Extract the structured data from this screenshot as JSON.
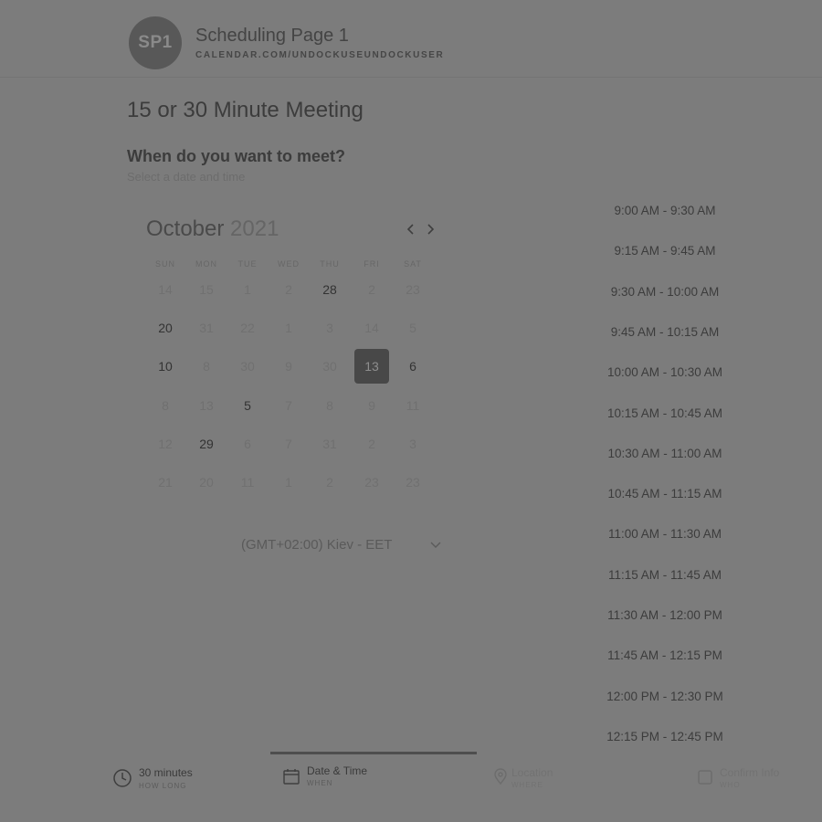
{
  "header": {
    "avatar_initials": "SP1",
    "page_name": "Scheduling Page 1",
    "url": "CALENDAR.COM/UNDOCKUSEUNDOCKUSER"
  },
  "meeting": {
    "title": "15 or 30 Minute Meeting",
    "question": "When do you want to meet?",
    "subtitle": "Select a date and time"
  },
  "calendar": {
    "month": "October",
    "year": "2021",
    "prev_icon": "chevron-left-icon",
    "next_icon": "chevron-right-icon",
    "weekdays": [
      "SUN",
      "MON",
      "TUE",
      "WED",
      "THU",
      "FRI",
      "SAT"
    ],
    "weeks": [
      [
        {
          "d": "14",
          "s": "faded"
        },
        {
          "d": "15",
          "s": "faded"
        },
        {
          "d": "1",
          "s": "faded"
        },
        {
          "d": "2",
          "s": "faded"
        },
        {
          "d": "28",
          "s": "available"
        },
        {
          "d": "2",
          "s": "faded"
        },
        {
          "d": "23",
          "s": "faded"
        }
      ],
      [
        {
          "d": "20",
          "s": "available"
        },
        {
          "d": "31",
          "s": "faded"
        },
        {
          "d": "22",
          "s": "faded"
        },
        {
          "d": "1",
          "s": "faded"
        },
        {
          "d": "3",
          "s": "faded"
        },
        {
          "d": "14",
          "s": "faded"
        },
        {
          "d": "5",
          "s": "faded"
        }
      ],
      [
        {
          "d": "10",
          "s": "available"
        },
        {
          "d": "8",
          "s": "faded"
        },
        {
          "d": "30",
          "s": "faded"
        },
        {
          "d": "9",
          "s": "faded"
        },
        {
          "d": "30",
          "s": "faded"
        },
        {
          "d": "13",
          "s": "selected"
        },
        {
          "d": "6",
          "s": "available"
        }
      ],
      [
        {
          "d": "8",
          "s": "faded"
        },
        {
          "d": "13",
          "s": "faded"
        },
        {
          "d": "5",
          "s": "available"
        },
        {
          "d": "7",
          "s": "faded"
        },
        {
          "d": "8",
          "s": "faded"
        },
        {
          "d": "9",
          "s": "faded"
        },
        {
          "d": "11",
          "s": "faded"
        }
      ],
      [
        {
          "d": "12",
          "s": "faded"
        },
        {
          "d": "29",
          "s": "available"
        },
        {
          "d": "6",
          "s": "faded"
        },
        {
          "d": "7",
          "s": "faded"
        },
        {
          "d": "31",
          "s": "faded"
        },
        {
          "d": "2",
          "s": "faded"
        },
        {
          "d": "3",
          "s": "faded"
        }
      ],
      [
        {
          "d": "21",
          "s": "faded"
        },
        {
          "d": "20",
          "s": "faded"
        },
        {
          "d": "11",
          "s": "faded"
        },
        {
          "d": "1",
          "s": "faded"
        },
        {
          "d": "2",
          "s": "faded"
        },
        {
          "d": "23",
          "s": "faded"
        },
        {
          "d": "23",
          "s": "faded"
        }
      ]
    ]
  },
  "timezone": {
    "value": "(GMT+02:00) Kiev - EET",
    "icon": "chevron-down-icon"
  },
  "time_slots": [
    "9:00 AM - 9:30 AM",
    "9:15 AM - 9:45 AM",
    "9:30 AM - 10:00 AM",
    "9:45 AM - 10:15 AM",
    "10:00 AM - 10:30 AM",
    "10:15 AM - 10:45 AM",
    "10:30 AM - 11:00 AM",
    "10:45 AM - 11:15 AM",
    "11:00 AM - 11:30 AM",
    "11:15 AM - 11:45 AM",
    "11:30 AM - 12:00 PM",
    "11:45 AM - 12:15 PM",
    "12:00 PM - 12:30 PM",
    "12:15 PM - 12:45 PM"
  ],
  "footer": {
    "steps": [
      {
        "label": "30 minutes",
        "sub": "HOW LONG",
        "icon": "clock-icon"
      },
      {
        "label": "Date & Time",
        "sub": "WHEN",
        "icon": "calendar-icon"
      },
      {
        "label": "Location",
        "sub": "WHERE",
        "icon": "location-pin-icon"
      },
      {
        "label": "Confirm Info",
        "sub": "WHO",
        "icon": "checkbox-icon"
      }
    ]
  },
  "colors": {
    "overlay_background": "#7c7c7c",
    "selected_day": "#484848",
    "active_step_underline": "#4e4e4e"
  }
}
